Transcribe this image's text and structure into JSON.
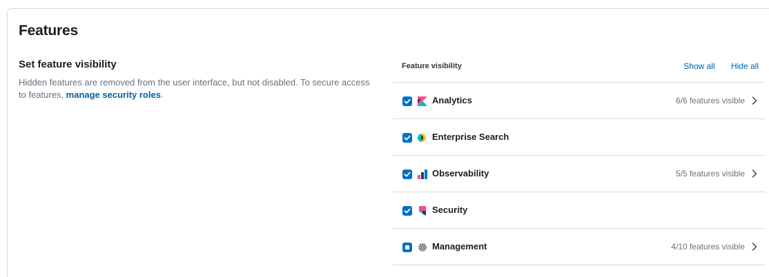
{
  "page": {
    "title": "Features"
  },
  "section": {
    "title": "Set feature visibility",
    "description": "Hidden features are removed from the user interface, but not disabled. To secure access to features, ",
    "link_text": "manage security roles",
    "description_end": "."
  },
  "feature_visibility": {
    "header_label": "Feature visibility",
    "show_all_label": "Show all",
    "hide_all_label": "Hide all",
    "features": [
      {
        "name": "Analytics",
        "icon": "analytics-icon",
        "state": "checked",
        "count": "6/6 features visible",
        "has_chevron": true
      },
      {
        "name": "Enterprise Search",
        "icon": "enterprise-search-icon",
        "state": "checked",
        "count": "",
        "has_chevron": false
      },
      {
        "name": "Observability",
        "icon": "observability-icon",
        "state": "checked",
        "count": "5/5 features visible",
        "has_chevron": true
      },
      {
        "name": "Security",
        "icon": "security-icon",
        "state": "checked",
        "count": "",
        "has_chevron": false
      },
      {
        "name": "Management",
        "icon": "gear-icon",
        "state": "indeterminate",
        "count": "4/10 features visible",
        "has_chevron": true
      }
    ]
  },
  "colors": {
    "accent": "#0071c2",
    "link": "#0061a6",
    "border": "#d3dae6",
    "muted_text": "#69707d"
  }
}
